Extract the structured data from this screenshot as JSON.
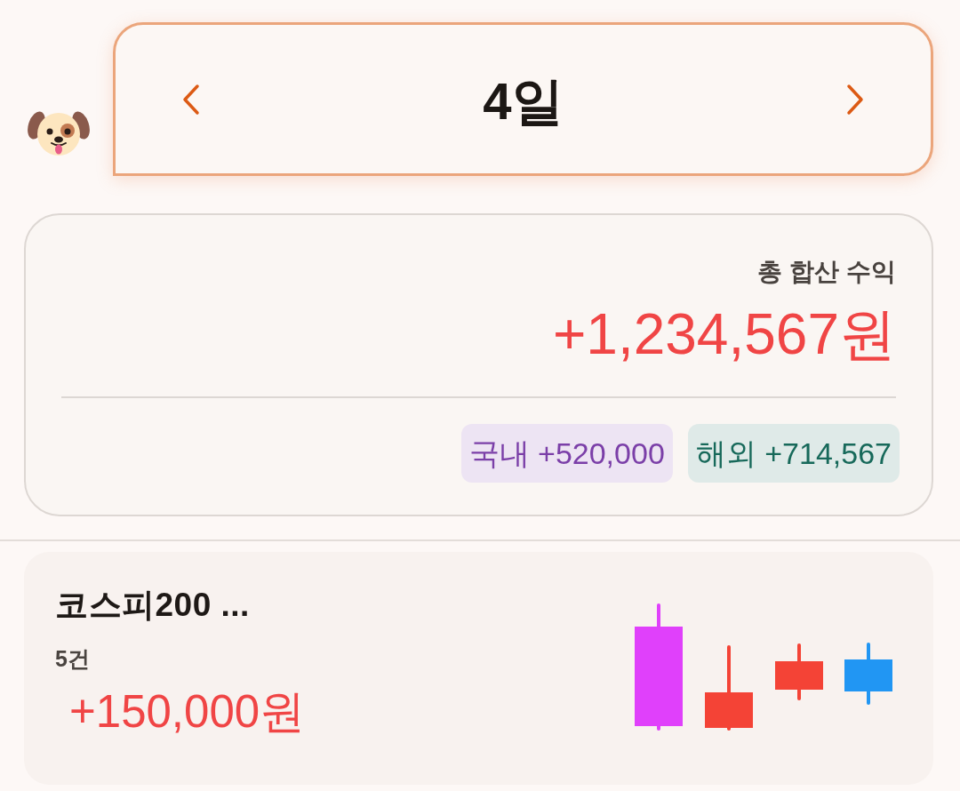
{
  "header": {
    "title": "4일"
  },
  "summary": {
    "label": "총 합산 수익",
    "total": "+1,234,567원",
    "badges": [
      {
        "label": "국내 +520,000",
        "color": "#7b3fa8"
      },
      {
        "label": "해외 +714,567",
        "color": "#17695a"
      }
    ]
  },
  "items": [
    {
      "name": "코스피200 ...",
      "count": "5건",
      "amount": "+150,000원"
    }
  ]
}
